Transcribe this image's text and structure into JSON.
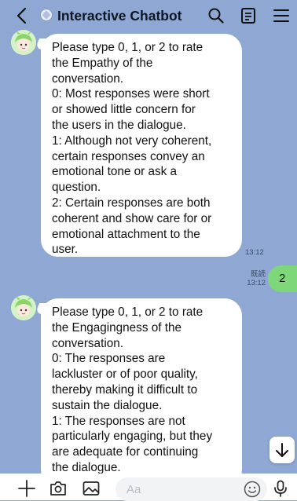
{
  "header": {
    "title": "Interactive Chatbot",
    "icons": [
      "back-icon",
      "official-badge-icon",
      "search-icon",
      "notes-icon",
      "menu-icon"
    ]
  },
  "messages": [
    {
      "sender": "bot",
      "lines": [
        "Please type 0, 1, or 2 to rate",
        "the Empathy of the",
        "conversation.",
        "0: Most responses were short",
        "or showed little concern for",
        "the users in the dialogue.",
        "1: Although not very coherent,",
        "certain responses convey an",
        "emotional tone or ask a",
        "question.",
        "2: Certain responses are both",
        "coherent and show care for or",
        "emotional attachment to the",
        "user."
      ],
      "time": "13:12"
    },
    {
      "sender": "user",
      "text": "2",
      "read_label": "既読",
      "time": "13:12"
    },
    {
      "sender": "bot",
      "lines": [
        "Please type 0, 1, or 2 to rate",
        "the Engagingness of the",
        "conversation.",
        "0: The responses are",
        "lackluster or of poor quality,",
        "thereby making it difficult to",
        "sustain the dialogue.",
        "1: The responses are not",
        "particularly engaging, but they",
        "are adequate for continuing",
        "the dialogue."
      ]
    }
  ],
  "composer": {
    "placeholder": "Aa",
    "icons": [
      "plus-icon",
      "camera-icon",
      "image-icon",
      "emoji-icon",
      "microphone-icon"
    ]
  },
  "colors": {
    "background": "#8fa8d3",
    "bot_bubble": "#ffffff",
    "user_bubble": "#7ed87a",
    "toolbar": "#ffffff"
  }
}
